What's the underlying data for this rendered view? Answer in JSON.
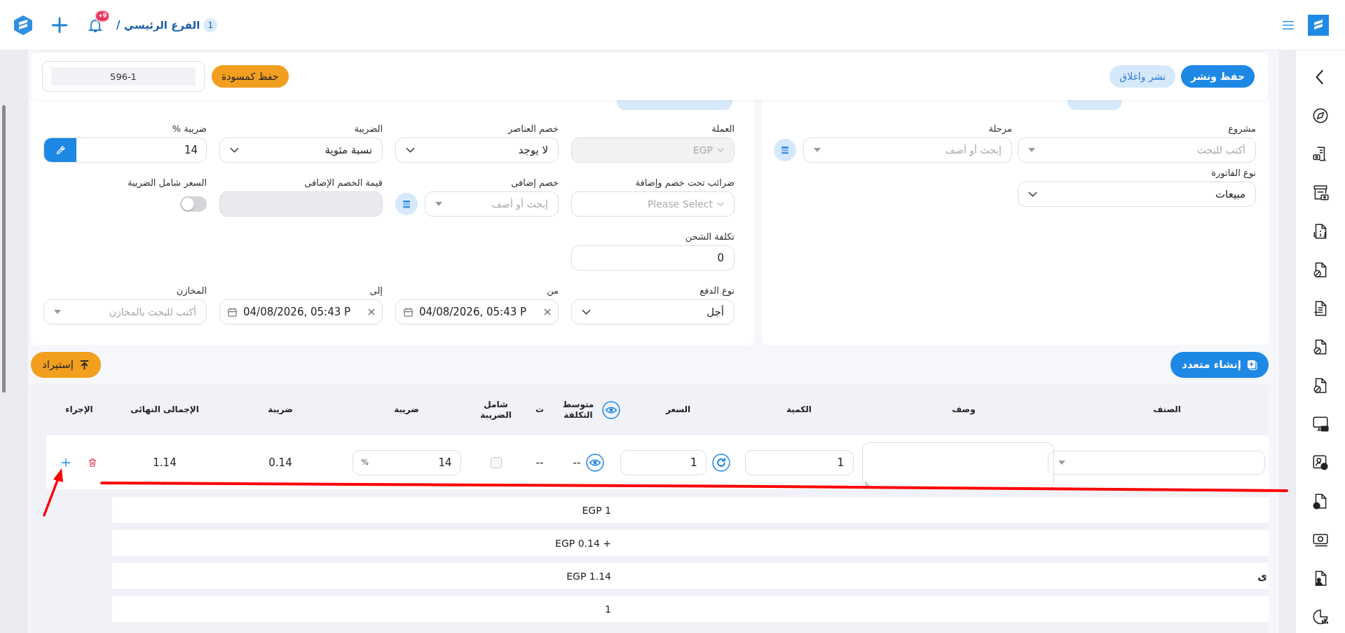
{
  "topbar": {
    "notifications_count": "+9",
    "branch": "الفرع الرئيسي /",
    "branch_count": "1"
  },
  "actions": {
    "publish": "حفظ ونشر",
    "publish_close": "نشر واغلاق",
    "draft": "حفظ كمسودة",
    "document_number": "596-1"
  },
  "invoice_rows": [
    [
      {
        "label": "مشروع",
        "kind": "search",
        "placeholder": "أكتب للبحث"
      },
      {
        "label": "مرحلة",
        "kind": "search-add",
        "placeholder": "إبحث أو أضف"
      }
    ],
    [
      {
        "label": "نوع الفاتورة",
        "kind": "select",
        "value": "مبيعات"
      }
    ]
  ],
  "settings_rows": [
    [
      {
        "label": "العملة",
        "kind": "dropdown",
        "value": "EGP",
        "disabled": true
      },
      {
        "label": "خصم العناصر",
        "kind": "select",
        "value": "لا يوجد"
      },
      {
        "label": "الضريبة",
        "kind": "select",
        "value": "نسبة مئوية"
      },
      {
        "label": "ضريبة %",
        "kind": "input-picker",
        "value": "14"
      }
    ],
    [
      {
        "label": "ضرائب تحت خصم وإضافة",
        "kind": "dropdown",
        "placeholder": "Please Select",
        "disabled": false
      },
      {
        "label": "خصم إضافى",
        "kind": "search-add",
        "placeholder": "إبحث أو أضف"
      },
      {
        "label": "قيمة الخصم الإضافى",
        "kind": "input",
        "disabled": true
      },
      {
        "label": "السعر شامل الضريبة",
        "kind": "toggle",
        "on": false
      }
    ],
    [
      {
        "label": "تكلفة الشحن",
        "kind": "input",
        "value": "0",
        "disabled": false
      }
    ],
    [
      {
        "label": "نوع الدفع",
        "kind": "select",
        "value": "أجل"
      },
      {
        "label": "من",
        "kind": "date",
        "value": "04/08/2026, 05:43 P"
      },
      {
        "label": "إلى",
        "kind": "date",
        "value": "04/08/2026, 05:43 P"
      },
      {
        "label": "المخازن",
        "kind": "search",
        "placeholder": "أكتب للبحث بالمخازن"
      }
    ]
  ],
  "toolbar": {
    "import": "إستيراد",
    "create_multiple": "إنشاء متعدد"
  },
  "table": {
    "columns": [
      {
        "label": "الصنف"
      },
      {
        "label": "وصف"
      },
      {
        "label": "الكمية"
      },
      {
        "label": "السعر"
      },
      {
        "label": "متوسط التكلفة",
        "visibility_toggle": true
      },
      {
        "label": "ت"
      },
      {
        "label": "شامل الضريبة"
      },
      {
        "label": "ضريبة"
      },
      {
        "label": "ضريبة"
      },
      {
        "label": "الإجمالى النهائى"
      },
      {
        "label": "الإجراء"
      }
    ],
    "rows": [
      {
        "cells": [
          {
            "kind": "select"
          },
          {
            "kind": "textarea"
          },
          {
            "kind": "input",
            "value": "1"
          },
          {
            "kind": "input-refresh",
            "value": "1"
          },
          {
            "kind": "eye-text",
            "value": "--"
          },
          {
            "kind": "text",
            "value": "--"
          },
          {
            "kind": "checkbox",
            "checked": false
          },
          {
            "kind": "percent-input",
            "value": "14",
            "unit": "%"
          },
          {
            "kind": "text",
            "value": "0.14"
          },
          {
            "kind": "text",
            "value": "1.14"
          },
          {
            "kind": "actions"
          }
        ]
      }
    ]
  },
  "summary": [
    {
      "value": "EGP 1"
    },
    {
      "value": "+ EGP 0.14"
    },
    {
      "label": "ى",
      "value": "EGP 1.14"
    },
    {
      "value": "1"
    }
  ]
}
